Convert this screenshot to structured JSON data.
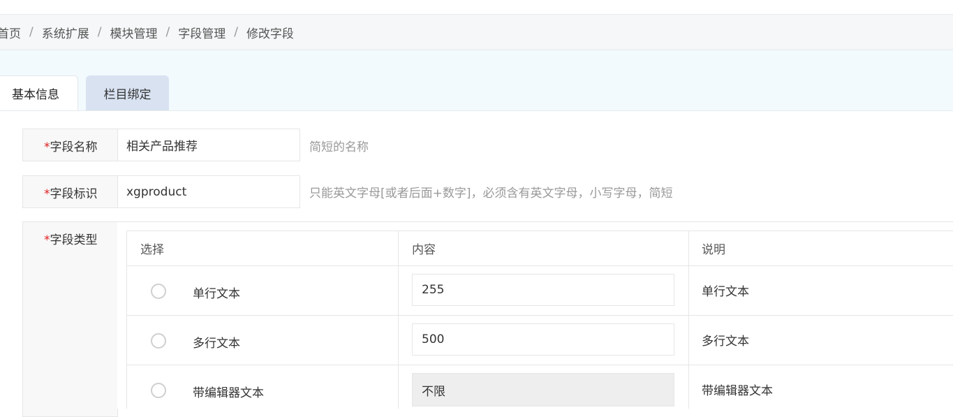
{
  "breadcrumb": {
    "items": [
      "首页",
      "系统扩展",
      "模块管理",
      "字段管理",
      "修改字段"
    ],
    "separator": "/"
  },
  "tabs": {
    "basic": "基本信息",
    "column_binding": "栏目绑定"
  },
  "form": {
    "required_mark": "*",
    "field_name": {
      "label": "字段名称",
      "value": "相关产品推荐",
      "hint": "简短的名称"
    },
    "field_identifier": {
      "label": "字段标识",
      "value": "xgproduct",
      "hint": "只能英文字母[或者后面+数字]，必须含有英文字母，小写字母，简短"
    },
    "field_type": {
      "label": "字段类型",
      "headers": {
        "select": "选择",
        "content": "内容",
        "description": "说明"
      },
      "options": [
        {
          "name": "单行文本",
          "content": "255",
          "description": "单行文本",
          "selected": false,
          "content_disabled": false
        },
        {
          "name": "多行文本",
          "content": "500",
          "description": "多行文本",
          "selected": false,
          "content_disabled": false
        },
        {
          "name": "带编辑器文本",
          "content": "不限",
          "description": "带编辑器文本",
          "selected": false,
          "content_disabled": true
        }
      ]
    }
  }
}
